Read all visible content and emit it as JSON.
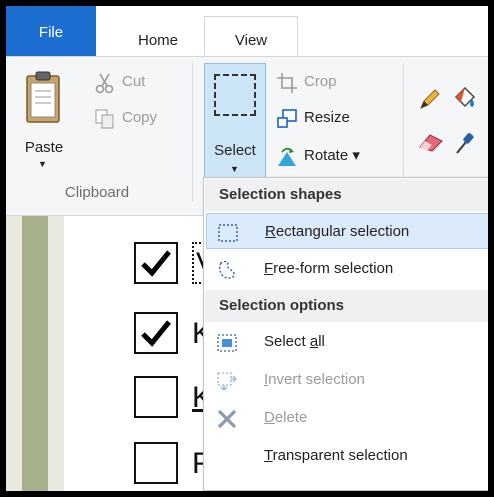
{
  "tabs": {
    "file": "File",
    "home": "Home",
    "view": "View"
  },
  "clipboard": {
    "paste": "Paste",
    "cut": "Cut",
    "copy": "Copy",
    "group_label": "Clipboard"
  },
  "image": {
    "select": "Select",
    "crop": "Crop",
    "resize": "Resize",
    "rotate": "Rotate",
    "rotate_arrow": "▾"
  },
  "tools": {
    "icons": [
      "pencil-icon",
      "fill-icon",
      "eraser-icon",
      "color-picker-icon"
    ]
  },
  "menu": {
    "shapes_header": "Selection shapes",
    "rect_pre": "",
    "rect_ul": "R",
    "rect_post": "ectangular selection",
    "free_ul": "F",
    "free_post": "ree-form selection",
    "options_header": "Selection options",
    "all_pre": "Select ",
    "all_ul": "a",
    "all_post": "ll",
    "invert_ul": "I",
    "invert_post": "nvert selection",
    "delete_ul": "D",
    "delete_post": "elete",
    "transparent_ul": "T",
    "transparent_post": "ransparent selection"
  },
  "canvas": {
    "items": [
      {
        "checked": true,
        "text": "V"
      },
      {
        "checked": true,
        "text": "K"
      },
      {
        "checked": false,
        "text": "K"
      },
      {
        "checked": false,
        "text": "F"
      }
    ]
  },
  "colors": {
    "file_tab": "#1c6fd1",
    "select_active": "#cde6f7",
    "menu_highlight": "#dcebfc"
  }
}
